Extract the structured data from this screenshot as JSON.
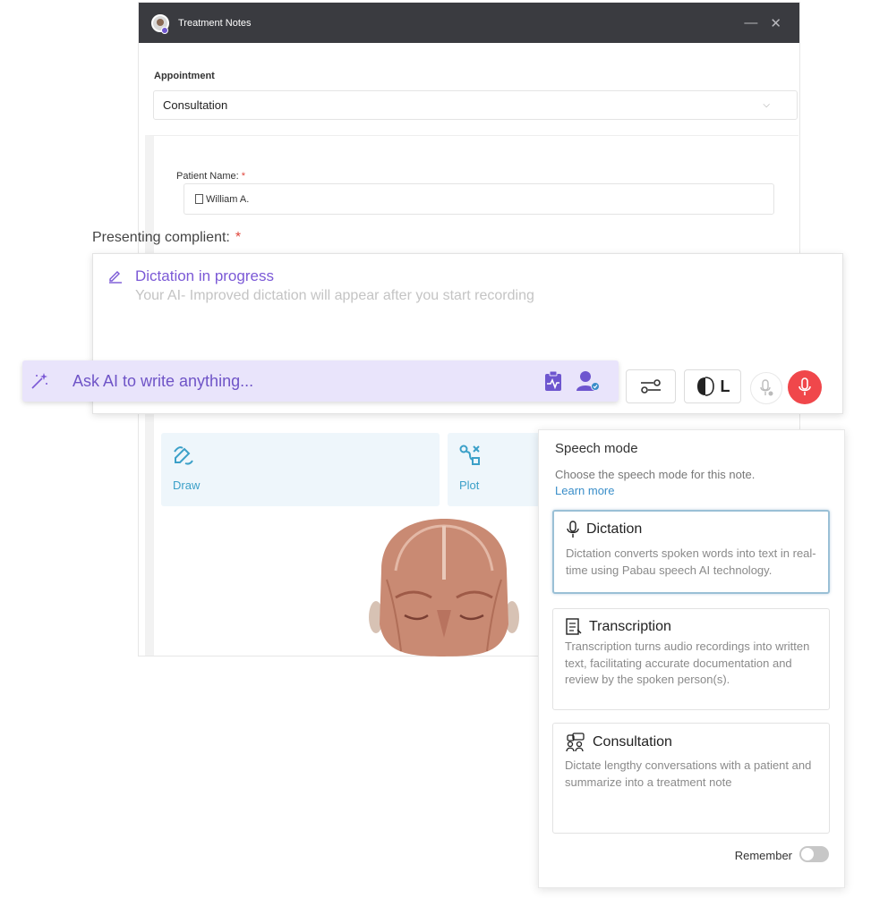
{
  "window": {
    "title": "Treatment Notes",
    "minimize_label": "—",
    "close_label": "✕"
  },
  "appointment": {
    "label": "Appointment",
    "value": "Consultation"
  },
  "patient": {
    "label": "Patient Name:",
    "required": "*",
    "value": "William A."
  },
  "presenting": {
    "label": "Presenting complient:",
    "required": "*"
  },
  "dictation": {
    "title": "Dictation in progress",
    "subtitle": "Your AI- Improved dictation will appear after you start recording"
  },
  "ai_bar": {
    "placeholder": "Ask AI to write anything..."
  },
  "toolbar": {
    "brain_letter": "L"
  },
  "tiles": {
    "draw": "Draw",
    "plot": "Plot"
  },
  "speech_mode": {
    "title": "Speech mode",
    "description": "Choose the speech mode for this note.",
    "learn_more": "Learn more",
    "options": [
      {
        "title": "Dictation",
        "description": "Dictation converts spoken words into text in real-time using Pabau speech AI technology.",
        "selected": true
      },
      {
        "title": "Transcription",
        "description": "Transcription turns audio recordings into written text, facilitating accurate documentation and review by the spoken person(s).",
        "selected": false
      },
      {
        "title": "Consultation",
        "description": "Dictate lengthy conversations with a patient and summarize into a treatment note",
        "selected": false
      }
    ],
    "remember_label": "Remember",
    "remember_on": false
  },
  "colors": {
    "accent_purple": "#7b59d6",
    "record_red": "#f0474b",
    "link_blue": "#3a8ec9",
    "tile_blue": "#3ba0c8"
  }
}
